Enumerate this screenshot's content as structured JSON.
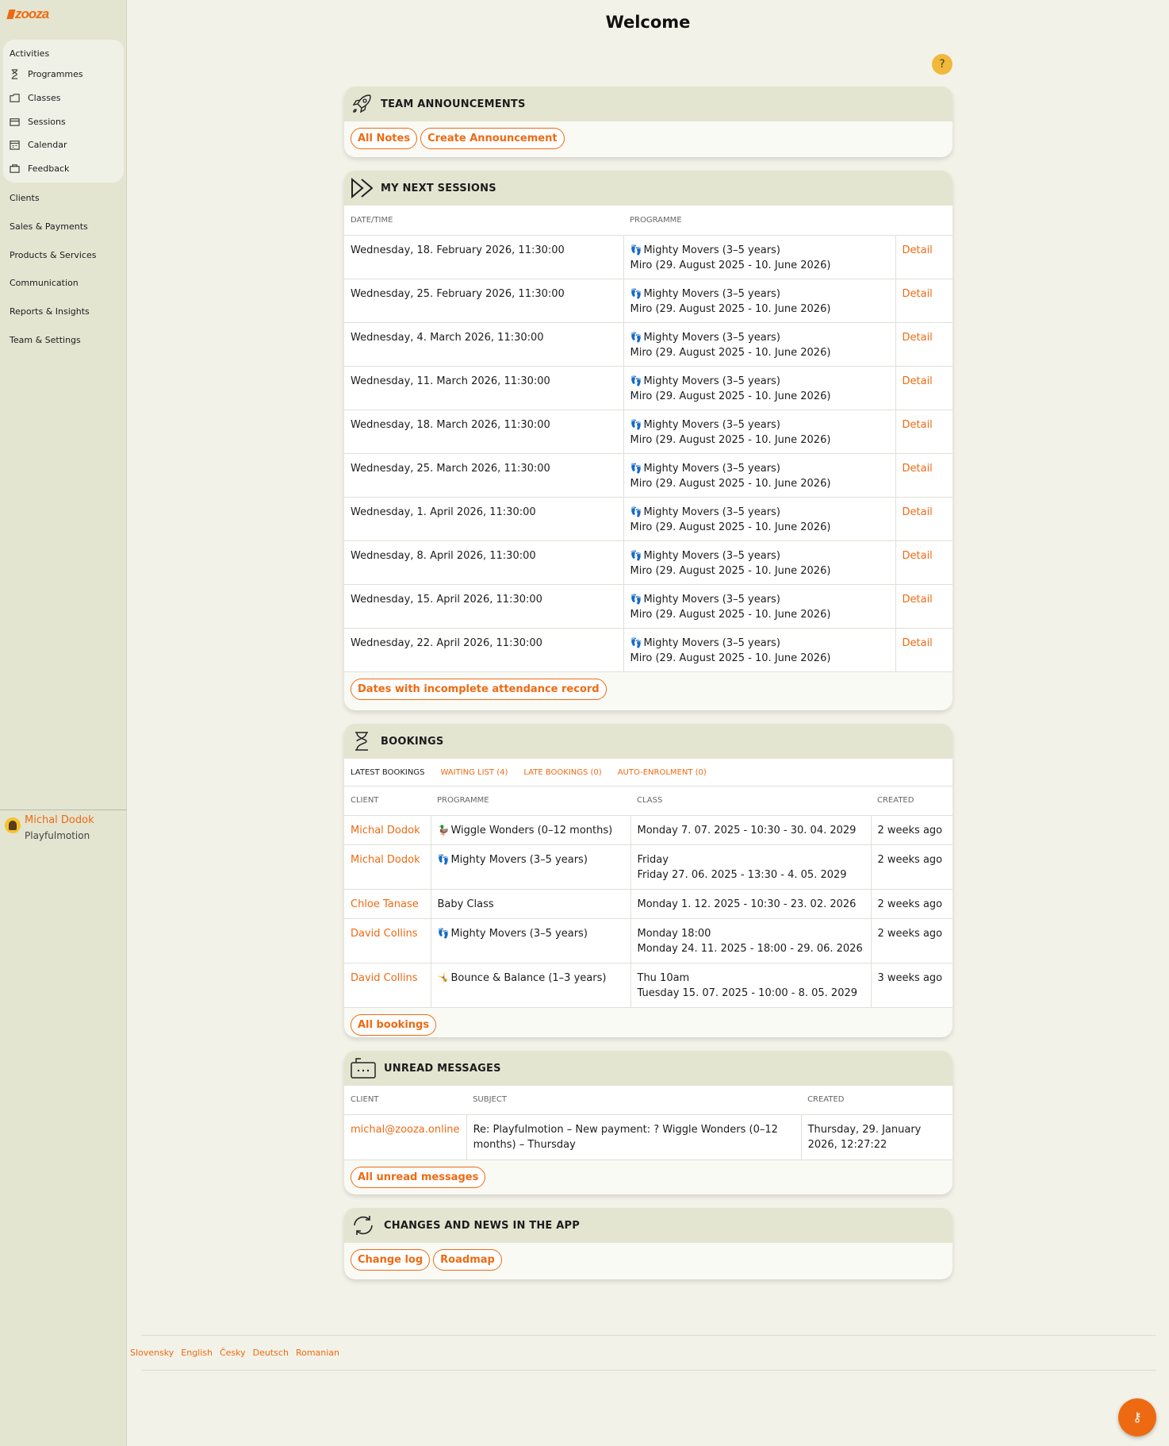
{
  "app": {
    "logo_text": "zooza",
    "page_title": "Welcome",
    "help_label": "?"
  },
  "sidebar": {
    "activities_title": "Activities",
    "activities_items": [
      {
        "label": "Programmes",
        "icon": "hourglass-icon"
      },
      {
        "label": "Classes",
        "icon": "folder-icon"
      },
      {
        "label": "Sessions",
        "icon": "sessions-icon"
      },
      {
        "label": "Calendar",
        "icon": "calendar-icon"
      },
      {
        "label": "Feedback",
        "icon": "feedback-icon"
      }
    ],
    "items": [
      "Clients",
      "Sales & Payments",
      "Products & Services",
      "Communication",
      "Reports & Insights",
      "Team & Settings"
    ],
    "user": {
      "name": "Michal Dodok",
      "org": "Playfulmotion"
    }
  },
  "announcements": {
    "title": "TEAM ANNOUNCEMENTS",
    "buttons": [
      "All Notes",
      "Create Announcement"
    ]
  },
  "next_sessions": {
    "title": "MY NEXT SESSIONS",
    "columns": [
      "DATE/TIME",
      "PROGRAMME"
    ],
    "rows": [
      {
        "date": "Wednesday, 18. February 2026, 11:30:00",
        "programme": "Mighty Movers (3–5 years)",
        "class": "Miro (29. August 2025 - 10. June 2026)",
        "action": "Detail"
      },
      {
        "date": "Wednesday, 25. February 2026, 11:30:00",
        "programme": "Mighty Movers (3–5 years)",
        "class": "Miro (29. August 2025 - 10. June 2026)",
        "action": "Detail"
      },
      {
        "date": "Wednesday, 4. March 2026, 11:30:00",
        "programme": "Mighty Movers (3–5 years)",
        "class": "Miro (29. August 2025 - 10. June 2026)",
        "action": "Detail"
      },
      {
        "date": "Wednesday, 11. March 2026, 11:30:00",
        "programme": "Mighty Movers (3–5 years)",
        "class": "Miro (29. August 2025 - 10. June 2026)",
        "action": "Detail"
      },
      {
        "date": "Wednesday, 18. March 2026, 11:30:00",
        "programme": "Mighty Movers (3–5 years)",
        "class": "Miro (29. August 2025 - 10. June 2026)",
        "action": "Detail"
      },
      {
        "date": "Wednesday, 25. March 2026, 11:30:00",
        "programme": "Mighty Movers (3–5 years)",
        "class": "Miro (29. August 2025 - 10. June 2026)",
        "action": "Detail"
      },
      {
        "date": "Wednesday, 1. April 2026, 11:30:00",
        "programme": "Mighty Movers (3–5 years)",
        "class": "Miro (29. August 2025 - 10. June 2026)",
        "action": "Detail"
      },
      {
        "date": "Wednesday, 8. April 2026, 11:30:00",
        "programme": "Mighty Movers (3–5 years)",
        "class": "Miro (29. August 2025 - 10. June 2026)",
        "action": "Detail"
      },
      {
        "date": "Wednesday, 15. April 2026, 11:30:00",
        "programme": "Mighty Movers (3–5 years)",
        "class": "Miro (29. August 2025 - 10. June 2026)",
        "action": "Detail"
      },
      {
        "date": "Wednesday, 22. April 2026, 11:30:00",
        "programme": "Mighty Movers (3–5 years)",
        "class": "Miro (29. August 2025 - 10. June 2026)",
        "action": "Detail"
      }
    ],
    "button": "Dates with incomplete attendance record"
  },
  "bookings": {
    "title": "BOOKINGS",
    "tabs": [
      "LATEST BOOKINGS",
      "WAITING LIST (4)",
      "LATE BOOKINGS (0)",
      "AUTO-ENROLMENT (0)"
    ],
    "columns": [
      "CLIENT",
      "PROGRAMME",
      "CLASS",
      "CREATED"
    ],
    "rows": [
      {
        "client": "Michal Dodok",
        "icon": "🦆",
        "programme": "Wiggle Wonders (0–12 months)",
        "class1": "Monday 7. 07. 2025 - 10:30 - 30. 04. 2029",
        "class2": "",
        "created": "2 weeks ago"
      },
      {
        "client": "Michal Dodok",
        "icon": "👣",
        "programme": "Mighty Movers (3–5 years)",
        "class1": "Friday",
        "class2": "Friday 27. 06. 2025 - 13:30 - 4. 05. 2029",
        "created": "2 weeks ago"
      },
      {
        "client": "Chloe Tanase",
        "icon": "",
        "programme": "Baby Class",
        "class1": "Monday 1. 12. 2025 - 10:30 - 23. 02. 2026",
        "class2": "",
        "created": "2 weeks ago"
      },
      {
        "client": "David Collins",
        "icon": "👣",
        "programme": "Mighty Movers (3–5 years)",
        "class1": "Monday 18:00",
        "class2": "Monday 24. 11. 2025 - 18:00 - 29. 06. 2026",
        "created": "2 weeks ago"
      },
      {
        "client": "David Collins",
        "icon": "🤸",
        "programme": "Bounce & Balance (1–3 years)",
        "class1": "Thu 10am",
        "class2": "Tuesday 15. 07. 2025 - 10:00 - 8. 05. 2029",
        "created": "3 weeks ago"
      }
    ],
    "button": "All bookings"
  },
  "messages": {
    "title": "UNREAD MESSAGES",
    "columns": [
      "CLIENT",
      "SUBJECT",
      "CREATED"
    ],
    "rows": [
      {
        "client": "michal@zooza.online",
        "subject": "Re: Playfulmotion – New payment: ? Wiggle Wonders (0–12 months) – Thursday",
        "created": "Thursday, 29. January 2026, 12:27:22"
      }
    ],
    "button": "All unread messages"
  },
  "changes": {
    "title": "CHANGES AND NEWS IN THE APP",
    "buttons": [
      "Change log",
      "Roadmap"
    ]
  },
  "footer": {
    "languages": [
      "Slovensky",
      "English",
      "Česky",
      "Deutsch",
      "Romanian"
    ]
  },
  "colors": {
    "accent": "#ee6a12",
    "sidebar": "#e3e5d1",
    "background": "#f2f2e8",
    "card_head": "#e3e5d1"
  }
}
